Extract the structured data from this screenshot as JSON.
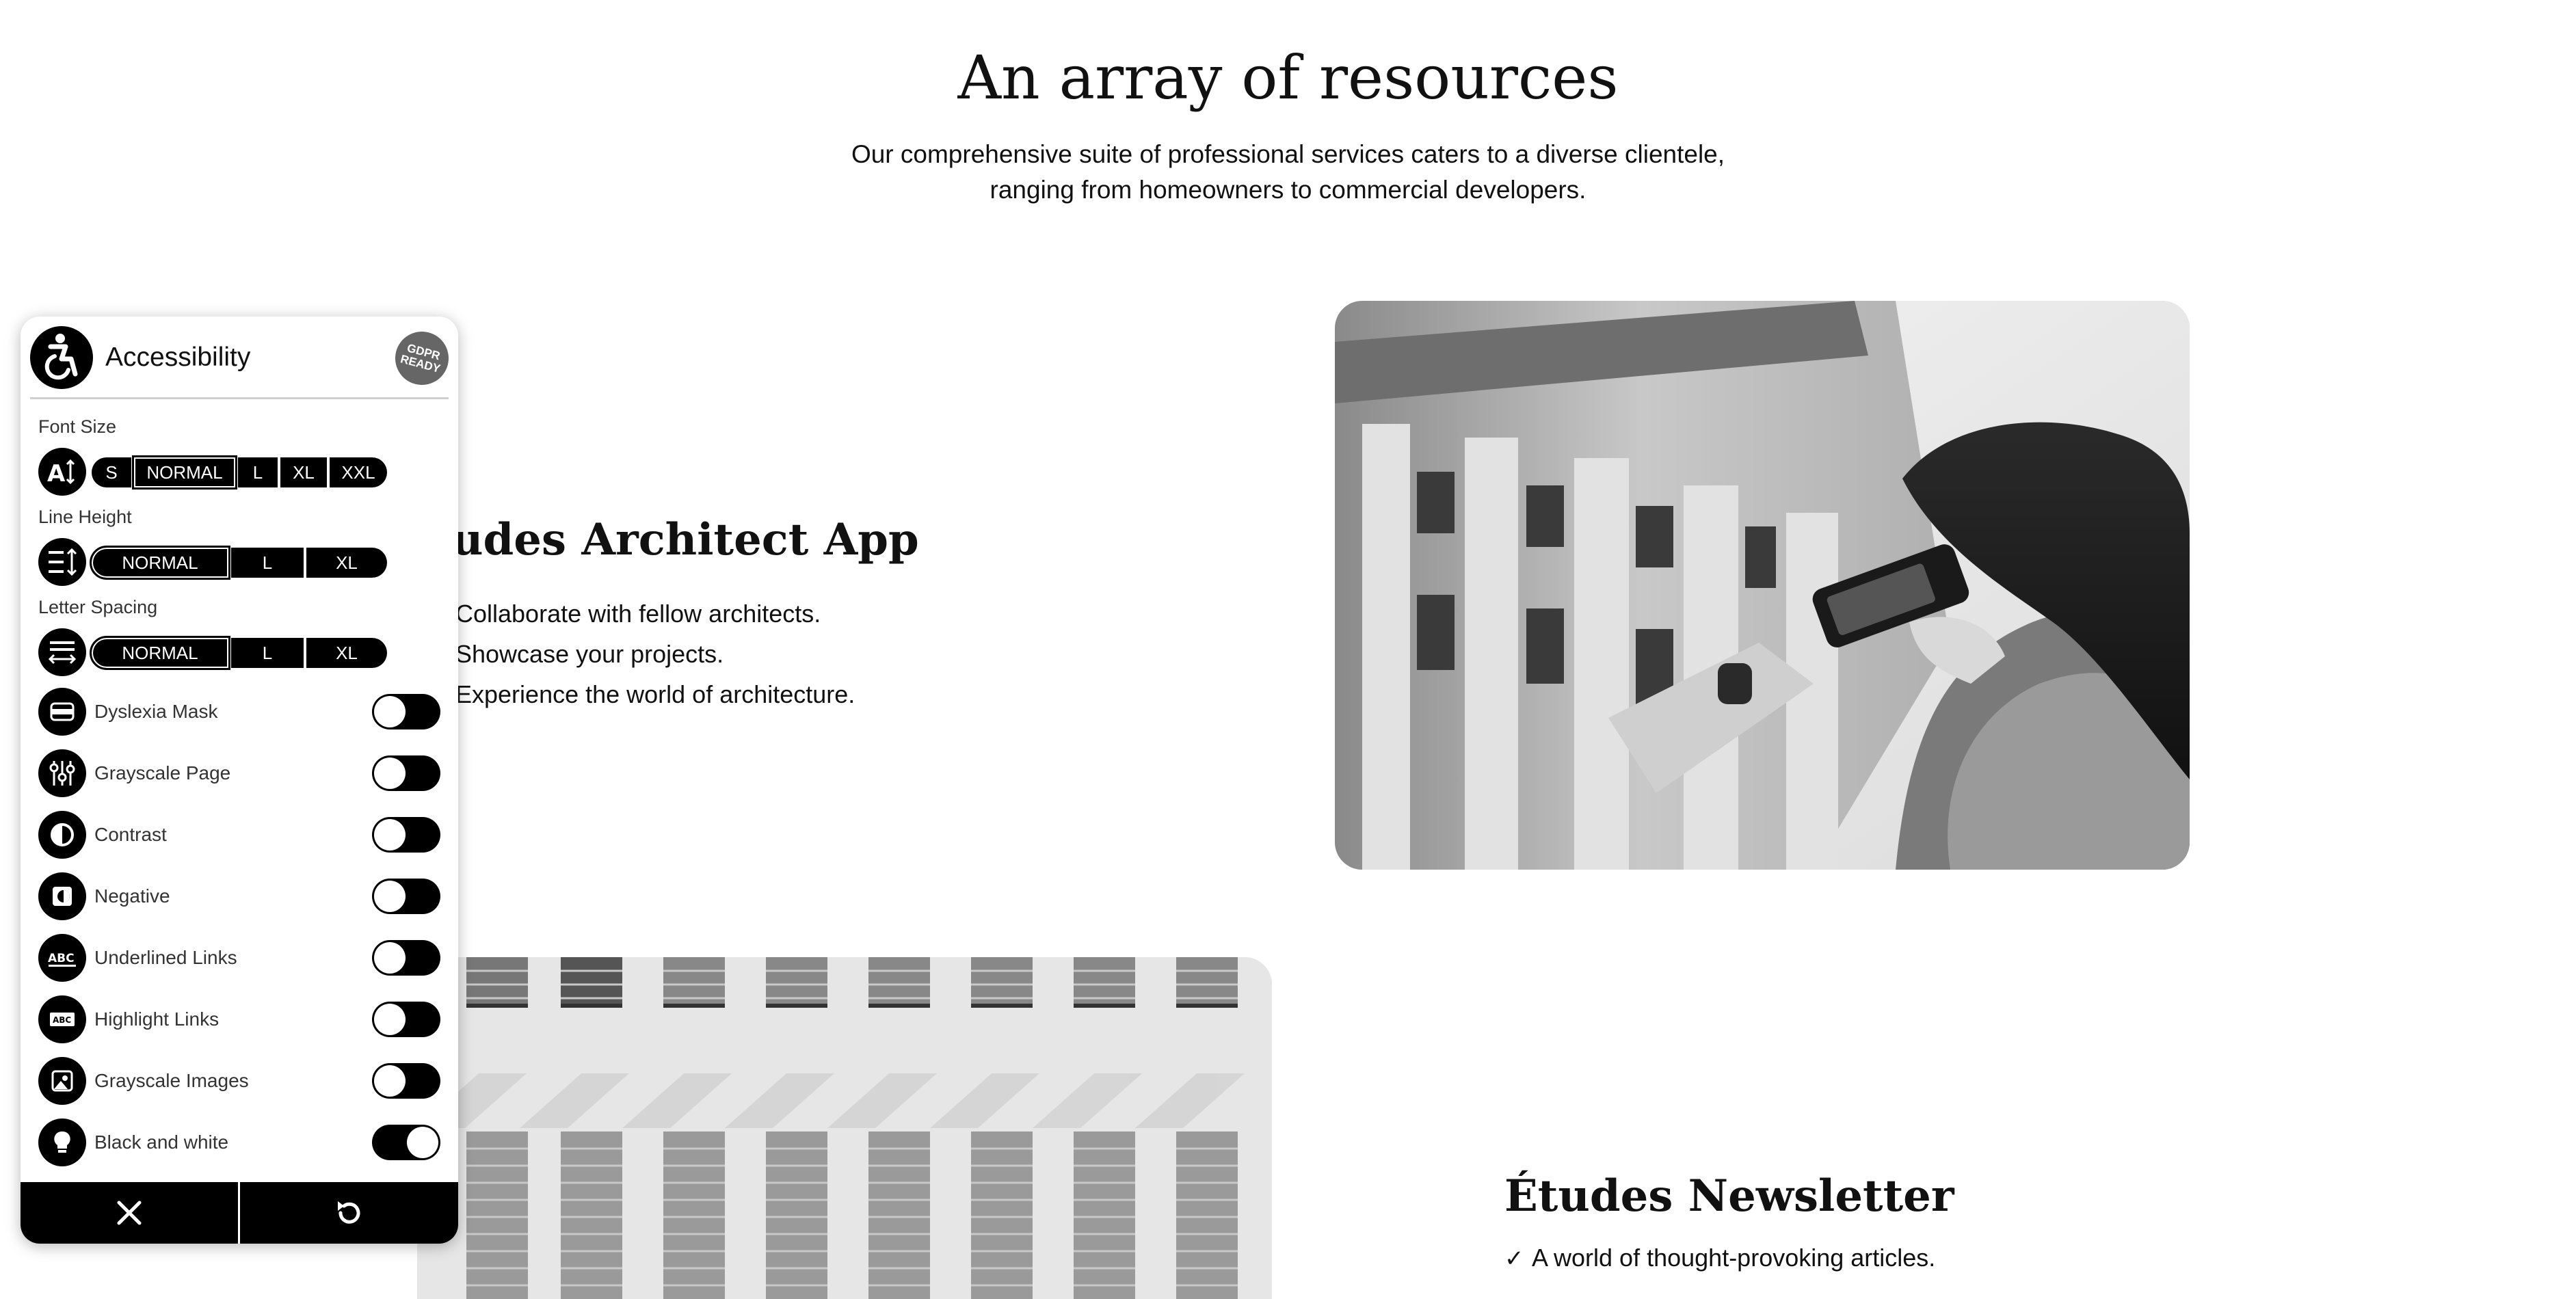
{
  "section": {
    "title": "An array of resources",
    "subtitle_line1": "Our comprehensive suite of professional services caters to a diverse clientele,",
    "subtitle_line2": "ranging from homeowners to commercial developers."
  },
  "app_feature": {
    "title": "udes Architect App",
    "items": [
      "Collaborate with fellow architects.",
      "Showcase your projects.",
      "Experience the world of architecture."
    ]
  },
  "newsletter_feature": {
    "title": "Études Newsletter",
    "items": [
      "A world of thought-provoking articles."
    ]
  },
  "widget": {
    "title": "Accessibility",
    "gdpr_badge": "GDPR READY",
    "font_size": {
      "label": "Font Size",
      "options": [
        "S",
        "NORMAL",
        "L",
        "XL",
        "XXL"
      ],
      "selected": "NORMAL"
    },
    "line_height": {
      "label": "Line Height",
      "options": [
        "NORMAL",
        "L",
        "XL"
      ],
      "selected": "NORMAL"
    },
    "letter_spacing": {
      "label": "Letter Spacing",
      "options": [
        "NORMAL",
        "L",
        "XL"
      ],
      "selected": "NORMAL"
    },
    "toggles": [
      {
        "label": "Dyslexia Mask",
        "icon": "dyslexia-mask-icon",
        "on": false
      },
      {
        "label": "Grayscale Page",
        "icon": "sliders-icon",
        "on": false
      },
      {
        "label": "Contrast",
        "icon": "contrast-icon",
        "on": false
      },
      {
        "label": "Negative",
        "icon": "negative-icon",
        "on": false
      },
      {
        "label": "Underlined Links",
        "icon": "underline-abc-icon",
        "on": false
      },
      {
        "label": "Highlight Links",
        "icon": "highlight-abc-icon",
        "on": false
      },
      {
        "label": "Grayscale Images",
        "icon": "image-icon",
        "on": false
      },
      {
        "label": "Black and white",
        "icon": "lightbulb-icon",
        "on": true
      }
    ],
    "footer": {
      "close_icon": "close-icon",
      "reset_icon": "reset-icon"
    }
  }
}
